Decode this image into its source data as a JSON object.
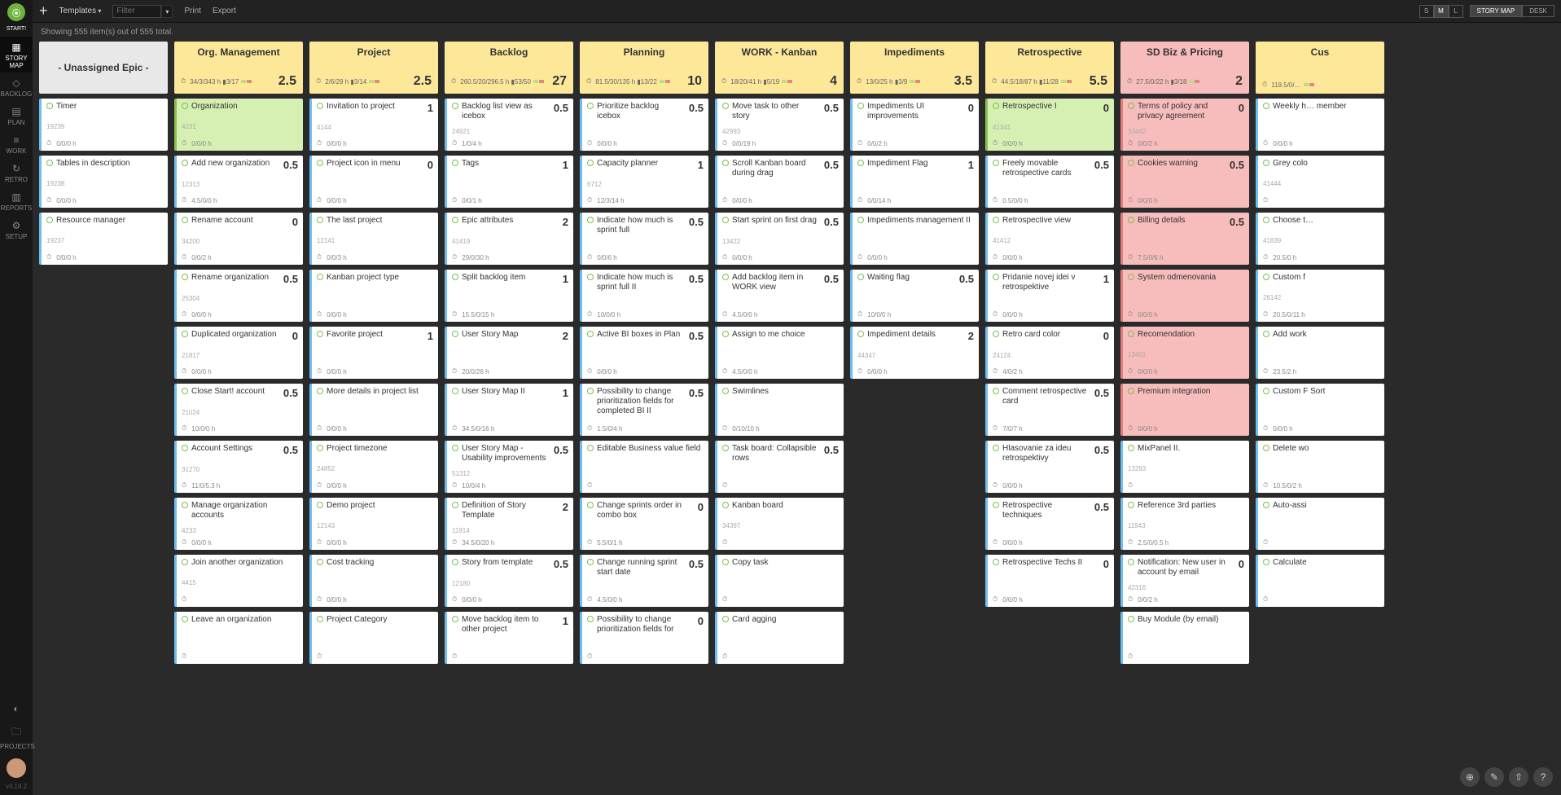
{
  "toolbar": {
    "templates": "Templates",
    "filter_placeholder": "Filter",
    "print": "Print",
    "export": "Export",
    "sizes": [
      "S",
      "M",
      "L"
    ],
    "size_active": 1,
    "views": [
      "STORY MAP",
      "DESK"
    ],
    "view_active": 0
  },
  "status": "Showing 555 item(s) out of 555 total.",
  "rail": {
    "start": "START!",
    "items": [
      {
        "icon": "▦",
        "label": "STORY MAP",
        "active": true
      },
      {
        "icon": "◇",
        "label": "BACKLOG"
      },
      {
        "icon": "▤",
        "label": "PLAN"
      },
      {
        "icon": "≡",
        "label": "WORK"
      },
      {
        "icon": "↻",
        "label": "RETRO"
      },
      {
        "icon": "▥",
        "label": "REPORTS"
      },
      {
        "icon": "⚙",
        "label": "SETUP"
      }
    ],
    "projects": "PROJECTS",
    "version": "v4.19.2"
  },
  "columns": [
    {
      "title": "- Unassigned Epic -",
      "headerClass": "gray",
      "stats": "",
      "big": "",
      "cards": [
        {
          "title": "Timer",
          "id": "19239",
          "meta": "0/0/0 h"
        },
        {
          "title": "Tables in description",
          "id": "19238",
          "meta": "0/0/0 h"
        },
        {
          "title": "Resource manager",
          "id": "19237",
          "meta": "0/0/0 h"
        }
      ]
    },
    {
      "title": "Org. Management",
      "headerClass": "yellow",
      "stats": "34/3/343 h   ▮3/17",
      "big": "2.5",
      "cards": [
        {
          "title": "Organization",
          "id": "4231",
          "meta": "0/0/0 h",
          "cls": "green",
          "score": ""
        },
        {
          "title": "Add new organization",
          "id": "12313",
          "meta": "4.5/0/0 h",
          "score": "0.5"
        },
        {
          "title": "Rename account",
          "id": "34200",
          "meta": "0/0/2 h",
          "score": "0"
        },
        {
          "title": "Rename organization",
          "id": "25304",
          "meta": "0/0/0 h",
          "score": "0.5"
        },
        {
          "title": "Duplicated organization",
          "id": "21817",
          "meta": "0/0/0 h",
          "score": "0"
        },
        {
          "title": "Close Start! account",
          "id": "21024",
          "meta": "10/0/0 h",
          "score": "0.5"
        },
        {
          "title": "Account Settings",
          "id": "31270",
          "meta": "11/0/5.3 h",
          "score": "0.5"
        },
        {
          "title": "Manage organization accounts",
          "id": "4233",
          "meta": "0/0/0 h"
        },
        {
          "title": "Join another organization",
          "id": "4415",
          "meta": ""
        },
        {
          "title": "Leave an organization",
          "id": "",
          "meta": ""
        }
      ]
    },
    {
      "title": "Project",
      "headerClass": "yellow",
      "stats": "2/6/29 h   ▮3/14",
      "big": "2.5",
      "cards": [
        {
          "title": "Invitation to project",
          "id": "4144",
          "meta": "0/0/0 h",
          "score": "1"
        },
        {
          "title": "Project icon in menu",
          "id": "",
          "meta": "0/0/0 h",
          "score": "0"
        },
        {
          "title": "The last project",
          "id": "12141",
          "meta": "0/0/3 h"
        },
        {
          "title": "Kanban project type",
          "id": "",
          "meta": "0/0/0 h"
        },
        {
          "title": "Favorite project",
          "id": "",
          "meta": "0/0/0 h",
          "score": "1"
        },
        {
          "title": "More details in project list",
          "id": "",
          "meta": "0/0/0 h"
        },
        {
          "title": "Project timezone",
          "id": "24852",
          "meta": "0/0/0 h"
        },
        {
          "title": "Demo project",
          "id": "12143",
          "meta": "0/0/0 h"
        },
        {
          "title": "Cost tracking",
          "id": "",
          "meta": "0/0/0 h"
        },
        {
          "title": "Project Category",
          "id": "",
          "meta": ""
        }
      ]
    },
    {
      "title": "Backlog",
      "headerClass": "yellow",
      "stats": "260.5/20/296.5 h   ▮53/50",
      "big": "27",
      "cards": [
        {
          "title": "Backlog list view as icebox",
          "id": "24921",
          "meta": "1/0/4 h",
          "score": "0.5"
        },
        {
          "title": "Tags",
          "id": "",
          "meta": "0/0/1 h",
          "score": "1"
        },
        {
          "title": "Epic attributes",
          "id": "41419",
          "meta": "29/0/30 h",
          "score": "2"
        },
        {
          "title": "Split backlog item",
          "id": "",
          "meta": "15.5/0/15 h",
          "score": "1"
        },
        {
          "title": "User Story Map",
          "id": "",
          "meta": "20/0/26 h",
          "score": "2"
        },
        {
          "title": "User Story Map II",
          "id": "",
          "meta": "34.5/0/16 h",
          "score": "1"
        },
        {
          "title": "User Story Map - Usability improvements",
          "id": "51312",
          "meta": "10/0/4 h",
          "score": "0.5"
        },
        {
          "title": "Definition of Story Template",
          "id": "11914",
          "meta": "34.5/0/20 h",
          "score": "2"
        },
        {
          "title": "Story from template",
          "id": "12180",
          "meta": "0/0/0 h",
          "score": "0.5"
        },
        {
          "title": "Move backlog item to other project",
          "id": "",
          "meta": "",
          "score": "1"
        }
      ]
    },
    {
      "title": "Planning",
      "headerClass": "yellow",
      "stats": "81.5/30/135 h   ▮13/22",
      "big": "10",
      "cards": [
        {
          "title": "Prioritize backlog icebox",
          "id": "",
          "meta": "0/0/0 h",
          "score": "0.5"
        },
        {
          "title": "Capacity planner",
          "id": "6712",
          "meta": "12/3/14 h",
          "score": "1"
        },
        {
          "title": "Indicate how much is sprint full",
          "id": "",
          "meta": "0/0/6 h",
          "score": "0.5"
        },
        {
          "title": "Indicate how much is sprint full II",
          "id": "",
          "meta": "10/0/0 h",
          "score": "0.5"
        },
        {
          "title": "Active BI boxes in Plan",
          "id": "",
          "meta": "0/0/0 h",
          "score": "0.5"
        },
        {
          "title": "Possibility to change prioritization fields for completed BI II",
          "id": "",
          "meta": "1.5/0/4 h",
          "score": "0.5"
        },
        {
          "title": "Editable Business value field",
          "id": "",
          "meta": ""
        },
        {
          "title": "Change sprints order in combo box",
          "id": "",
          "meta": "5.5/0/1 h",
          "score": "0"
        },
        {
          "title": "Change running sprint start date",
          "id": "",
          "meta": "4.5/0/0 h",
          "score": "0.5"
        },
        {
          "title": "Possibility to change prioritization fields for",
          "id": "",
          "meta": "",
          "score": "0"
        }
      ]
    },
    {
      "title": "WORK - Kanban",
      "headerClass": "yellow",
      "stats": "18/20/41 h   ▮5/19",
      "big": "4",
      "cards": [
        {
          "title": "Move task to other story",
          "id": "42993",
          "meta": "0/0/19 h",
          "score": "0.5"
        },
        {
          "title": "Scroll Kanban board during drag",
          "id": "",
          "meta": "0/0/0 h",
          "score": "0.5"
        },
        {
          "title": "Start sprint on first drag",
          "id": "13422",
          "meta": "0/0/0 h",
          "score": "0.5"
        },
        {
          "title": "Add backlog item in WORK view",
          "id": "",
          "meta": "4.5/0/0 h",
          "score": "0.5"
        },
        {
          "title": "Assign to me choice",
          "id": "",
          "meta": "4.5/0/0 h"
        },
        {
          "title": "Swimlines",
          "id": "",
          "meta": "0/10/10 h"
        },
        {
          "title": "Task board: Collapsible rows",
          "id": "",
          "meta": "",
          "score": "0.5"
        },
        {
          "title": "Kanban board",
          "id": "34397",
          "meta": ""
        },
        {
          "title": "Copy task",
          "id": "",
          "meta": ""
        },
        {
          "title": "Card agging",
          "id": "",
          "meta": ""
        }
      ]
    },
    {
      "title": "Impediments",
      "headerClass": "yellow",
      "stats": "13/0/25 h   ▮3/9",
      "big": "3.5",
      "cards": [
        {
          "title": "Impediments UI improvements",
          "id": "",
          "meta": "0/0/2 h",
          "score": "0"
        },
        {
          "title": "Impediment Flag",
          "id": "",
          "meta": "0/0/14 h",
          "score": "1"
        },
        {
          "title": "Impediments management II",
          "id": "",
          "meta": "0/0/0 h"
        },
        {
          "title": "Waiting flag",
          "id": "",
          "meta": "10/0/0 h",
          "score": "0.5"
        },
        {
          "title": "Impediment details",
          "id": "44347",
          "meta": "0/0/0 h",
          "score": "2"
        }
      ]
    },
    {
      "title": "Retrospective",
      "headerClass": "yellow",
      "stats": "44.5/18/87 h   ▮11/28",
      "big": "5.5",
      "cards": [
        {
          "title": "Retrospective I",
          "id": "41341",
          "meta": "0/0/0 h",
          "cls": "green",
          "score": "0"
        },
        {
          "title": "Freely movable retrospective cards",
          "id": "",
          "meta": "0.5/0/0 h",
          "score": "0.5"
        },
        {
          "title": "Retrospective view",
          "id": "41412",
          "meta": "0/0/0 h"
        },
        {
          "title": "Pridanie novej idei v retrospektive",
          "id": "",
          "meta": "0/0/0 h",
          "score": "1"
        },
        {
          "title": "Retro card color",
          "id": "24124",
          "meta": "4/0/2 h",
          "score": "0"
        },
        {
          "title": "Comment retrospective card",
          "id": "",
          "meta": "7/0/7 h",
          "score": "0.5"
        },
        {
          "title": "Hlasovanie za ideu retrospektivy",
          "id": "",
          "meta": "0/0/0 h",
          "score": "0.5"
        },
        {
          "title": "Retrospective techniques",
          "id": "",
          "meta": "0/0/0 h",
          "score": "0.5"
        },
        {
          "title": "Retrospective Techs II",
          "id": "",
          "meta": "0/0/0 h",
          "score": "0"
        }
      ]
    },
    {
      "title": "SD Biz & Pricing",
      "headerClass": "pink",
      "stats": "27.5/0/22 h   ▮3/18",
      "big": "2",
      "cards": [
        {
          "title": "Terms of policy and privacy agreement",
          "id": "33442",
          "meta": "0/0/2 h",
          "score": "0",
          "cls": "pink"
        },
        {
          "title": "Cookies warning",
          "id": "",
          "meta": "0/0/0 h",
          "score": "0.5",
          "cls": "pink"
        },
        {
          "title": "Billing details",
          "id": "",
          "meta": "7.5/0/6 h",
          "score": "0.5",
          "cls": "pink"
        },
        {
          "title": "System odmenovania",
          "id": "",
          "meta": "0/0/0 h",
          "cls": "pink"
        },
        {
          "title": "Recomendation",
          "id": "13401",
          "meta": "0/0/0 h",
          "cls": "pink"
        },
        {
          "title": "Premium integration",
          "id": "",
          "meta": "0/0/0 h",
          "cls": "pink"
        },
        {
          "title": "MixPanel II.",
          "id": "13293",
          "meta": ""
        },
        {
          "title": "Reference 3rd parties",
          "id": "11943",
          "meta": "2.5/0/0.5 h"
        },
        {
          "title": "Notification: New user in account by email",
          "id": "42316",
          "meta": "0/0/2 h",
          "score": "0"
        },
        {
          "title": "Buy Module (by email)",
          "id": "",
          "meta": ""
        }
      ]
    },
    {
      "title": "Cus",
      "headerClass": "yellow",
      "stats": "119.5/0/…",
      "big": "",
      "cards": [
        {
          "title": "Weekly h… member",
          "id": "",
          "meta": "0/0/0 h"
        },
        {
          "title": "Grey colo",
          "id": "41444",
          "meta": ""
        },
        {
          "title": "Choose t…",
          "id": "41839",
          "meta": "20.5/0 h"
        },
        {
          "title": "Custom f",
          "id": "26142",
          "meta": "20.5/0/11 h"
        },
        {
          "title": "Add work",
          "id": "",
          "meta": "23.5/2 h"
        },
        {
          "title": "Custom F Sort",
          "id": "",
          "meta": "0/0/0 h"
        },
        {
          "title": "Delete wo",
          "id": "",
          "meta": "10.5/0/2 h"
        },
        {
          "title": "Auto-assi",
          "id": "",
          "meta": ""
        },
        {
          "title": "Calculate",
          "id": "",
          "meta": ""
        }
      ]
    }
  ]
}
